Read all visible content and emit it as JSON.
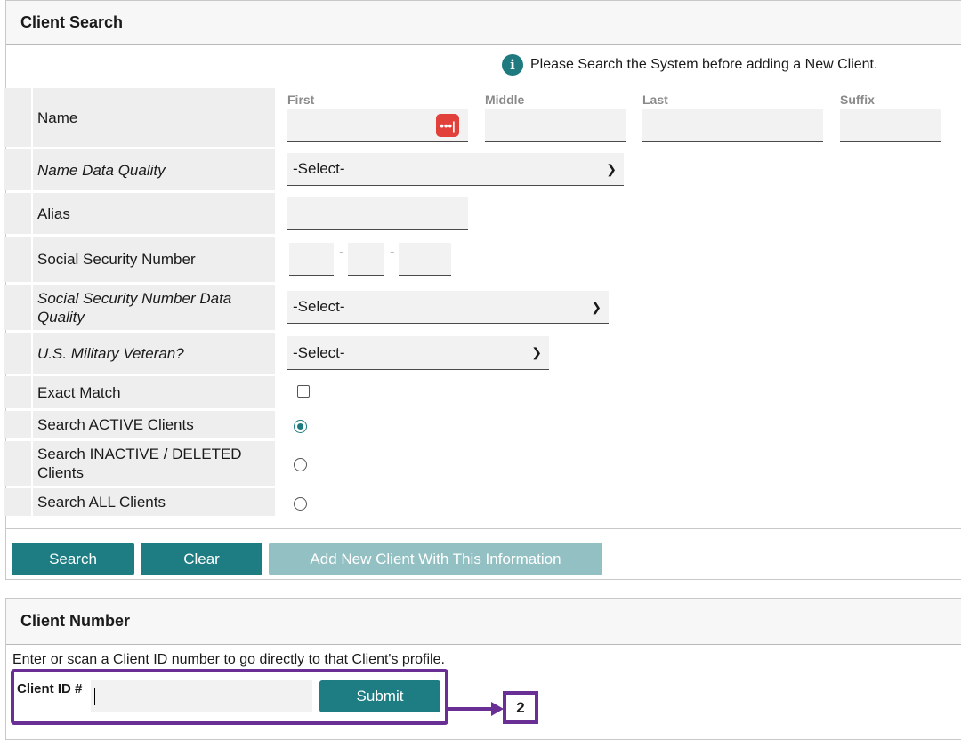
{
  "client_search": {
    "title": "Client Search",
    "notice": "Please Search the System before adding a New Client.",
    "name": {
      "label": "Name",
      "first_label": "First",
      "middle_label": "Middle",
      "last_label": "Last",
      "suffix_label": "Suffix"
    },
    "name_data_quality": {
      "label": "Name Data Quality",
      "selected": "-Select-"
    },
    "alias": {
      "label": "Alias"
    },
    "ssn": {
      "label": "Social Security Number",
      "separator": "-"
    },
    "ssn_data_quality": {
      "label": "Social Security Number Data Quality",
      "selected": "-Select-"
    },
    "veteran": {
      "label": "U.S. Military Veteran?",
      "selected": "-Select-"
    },
    "exact_match": {
      "label": "Exact Match",
      "checked": false
    },
    "search_active": {
      "label": "Search ACTIVE Clients",
      "selected": true
    },
    "search_inactive": {
      "label": "Search INACTIVE / DELETED Clients",
      "selected": false
    },
    "search_all": {
      "label": "Search ALL Clients",
      "selected": false
    },
    "buttons": {
      "search": "Search",
      "clear": "Clear",
      "add_new": "Add New Client With This Information"
    }
  },
  "client_number": {
    "title": "Client Number",
    "instructions": "Enter or scan a Client ID number to go directly to that Client's profile.",
    "client_id_label": "Client ID #",
    "submit": "Submit"
  },
  "callout": {
    "number": "2",
    "color": "#6a2f95"
  },
  "colors": {
    "accent": "#1e7d82",
    "accent_disabled": "#93c0c3",
    "password_manager_icon": "#e2413b"
  },
  "icons": {
    "notice": "info-icon",
    "password_field": "password-manager-icon",
    "dropdown": "chevron-down-icon"
  }
}
